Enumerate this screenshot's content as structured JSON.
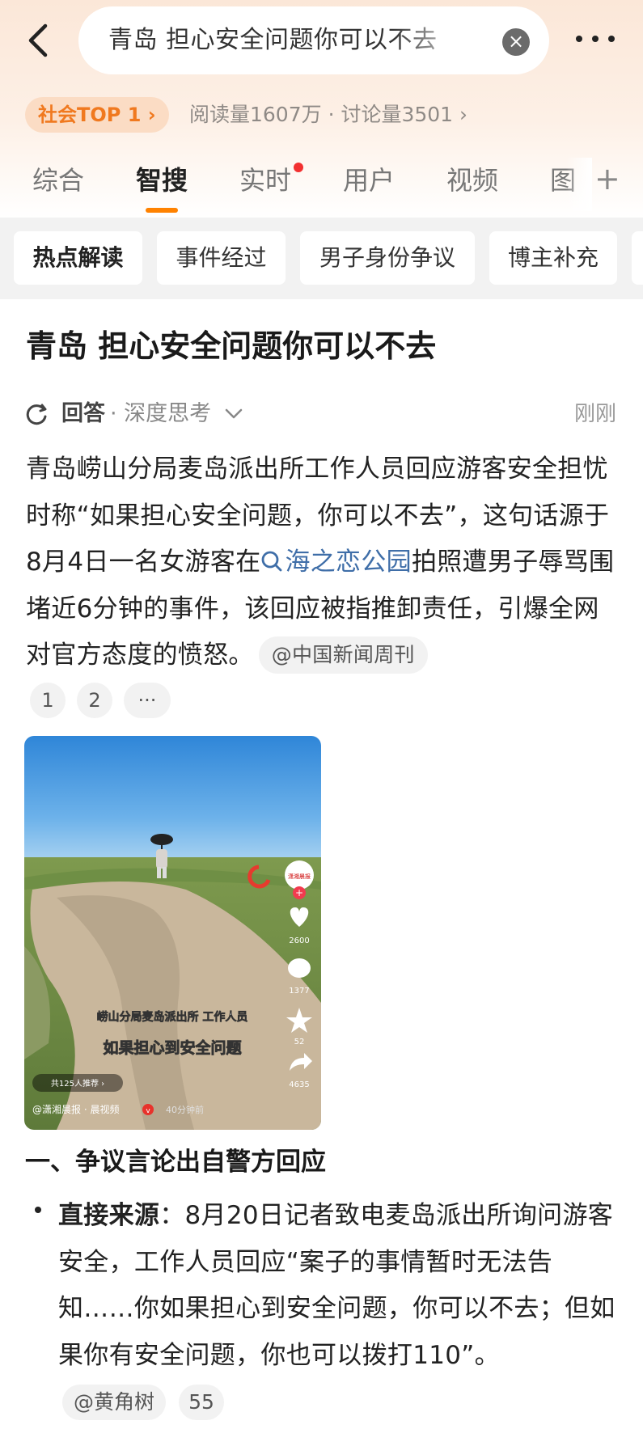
{
  "search": {
    "query": "青岛 担心安全问题你可以不去",
    "icons": {
      "back": "chevron-left-icon",
      "clear": "close-circle-icon",
      "more": "more-dots-icon"
    }
  },
  "rank": {
    "badge": "社会TOP 1 ›",
    "stats": "阅读量1607万 · 讨论量3501 ›"
  },
  "tabs": {
    "items": [
      "综合",
      "智搜",
      "实时",
      "用户",
      "视频",
      "图"
    ],
    "active": "智搜",
    "plus": "+"
  },
  "chips": [
    "热点解读",
    "事件经过",
    "男子身份争议",
    "博主补充"
  ],
  "article": {
    "title": "青岛 担心安全问题你可以不去",
    "answer_label": "回答",
    "answer_mode": "· 深度思考",
    "timestamp": "刚刚",
    "paragraph_part1": "青岛崂山分局麦岛派出所工作人员回应游客安全担忧时称“如果担心安全问题，你可以不去”，这句话源于8月4日一名女游客在",
    "link": "海之恋公园",
    "paragraph_part2": "拍照遭男子辱骂围堵近6分钟的事件，该回应被指推卸责任，引爆全网对官方态度的愤怒。",
    "source": "@中国新闻周刊",
    "citations": [
      "1",
      "2",
      "···"
    ]
  },
  "video": {
    "caption_line1": "崂山分局麦岛派出所 工作人员",
    "caption_line2": "如果担心到安全问题",
    "recommend": "共125人推荐 ›",
    "author": "@潇湘晨报 · 晨视频",
    "time_ago": "40分钟前",
    "likes": "2600",
    "comments": "1377",
    "favorites": "52",
    "shares": "4635",
    "channel_logo": "潇湘晨报"
  },
  "section": {
    "heading": "一、争议言论出自警方回应",
    "bullet_label": "直接来源",
    "bullet_text": "：8月20日记者致电麦岛派出所询问游客安全，工作人员回应“案子的事情暂时无法告知……你如果担心到安全问题，你可以不去；但如果你有安全问题，你也可以拨打110”。",
    "tag_source": "@黄角树",
    "tag_count": "55"
  },
  "colors": {
    "accent": "#ff8200",
    "rank_text": "#f0791f",
    "link": "#3f6ea8",
    "notify_dot": "#f23030",
    "header_gradient_top": "#fbe7d8"
  }
}
